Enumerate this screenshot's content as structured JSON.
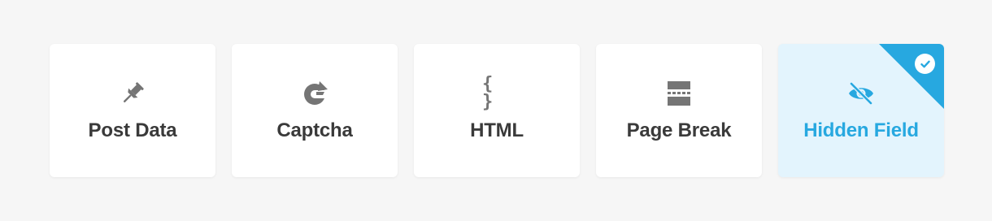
{
  "fields": [
    {
      "label": "Post Data",
      "icon": "pin-icon",
      "selected": false
    },
    {
      "label": "Captcha",
      "icon": "captcha-refresh-icon",
      "selected": false
    },
    {
      "label": "HTML",
      "icon": "curly-braces-icon",
      "glyph": "{ }",
      "selected": false
    },
    {
      "label": "Page Break",
      "icon": "page-break-icon",
      "selected": false
    },
    {
      "label": "Hidden Field",
      "icon": "eye-slash-icon",
      "selected": true
    }
  ],
  "colors": {
    "background": "#f6f6f6",
    "card": "#ffffff",
    "selected_card": "#e3f4fd",
    "accent": "#27a8e0",
    "icon": "#757575",
    "label": "#3a3a3a"
  }
}
